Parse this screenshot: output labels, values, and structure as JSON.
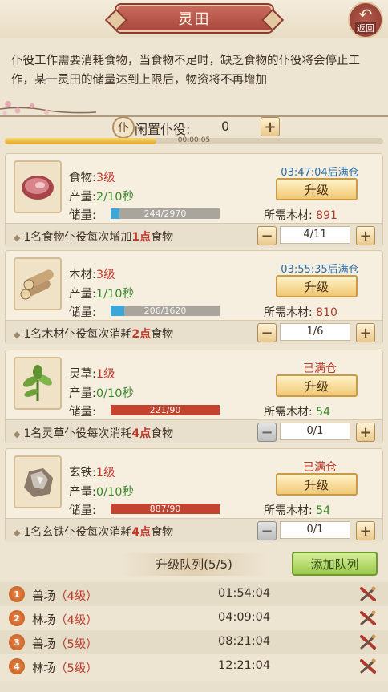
{
  "header": {
    "title": "灵田",
    "back_label": "返回"
  },
  "description": "仆役工作需要消耗食物，当食物不足时，缺乏食物的仆役将会停止工作，某一灵田的储量达到上限后，物资将不再增加",
  "idle": {
    "label": "闲置仆役:",
    "value": "0",
    "timer": "00:00:05",
    "timer_progress": 0.4
  },
  "labels": {
    "output": "产量:",
    "storage": "储量:",
    "wood_needed": "所需木材:",
    "upgrade": "升级"
  },
  "resources": [
    {
      "name": "食物:",
      "level": "3级",
      "rate": "2/10秒",
      "storage_text": "244/2970",
      "fill": 0.082,
      "full": false,
      "status": "03:47:04后满仓",
      "wood": "891",
      "wood_enough": false,
      "note_a": "1名食物仆役每次增加",
      "note_num": "1点",
      "note_b": "食物",
      "count": "4/11",
      "minus_enabled": true,
      "icon": "meat-icon"
    },
    {
      "name": "木材:",
      "level": "3级",
      "rate": "1/10秒",
      "storage_text": "206/1620",
      "fill": 0.127,
      "full": false,
      "status": "03:55:35后满仓",
      "wood": "810",
      "wood_enough": false,
      "note_a": "1名木材仆役每次消耗",
      "note_num": "2点",
      "note_b": "食物",
      "count": "1/6",
      "minus_enabled": true,
      "icon": "log-icon"
    },
    {
      "name": "灵草:",
      "level": "1级",
      "rate": "0/10秒",
      "storage_text": "221/90",
      "fill": 1,
      "full": true,
      "status": "已满仓",
      "wood": "54",
      "wood_enough": true,
      "note_a": "1名灵草仆役每次消耗",
      "note_num": "4点",
      "note_b": "食物",
      "count": "0/1",
      "minus_enabled": false,
      "icon": "herb-icon"
    },
    {
      "name": "玄铁:",
      "level": "1级",
      "rate": "0/10秒",
      "storage_text": "887/90",
      "fill": 1,
      "full": true,
      "status": "已满仓",
      "wood": "54",
      "wood_enough": true,
      "note_a": "1名玄铁仆役每次消耗",
      "note_num": "4点",
      "note_b": "食物",
      "count": "0/1",
      "minus_enabled": false,
      "icon": "iron-ore-icon"
    }
  ],
  "queue": {
    "title": "升级队列(5/5)",
    "add_label": "添加队列",
    "items": [
      {
        "num": "1",
        "name": "兽场",
        "level": "（4级）",
        "time": "01:54:04"
      },
      {
        "num": "2",
        "name": "林场",
        "level": "（4级）",
        "time": "04:09:04"
      },
      {
        "num": "3",
        "name": "兽场",
        "level": "（5级）",
        "time": "08:21:04"
      },
      {
        "num": "4",
        "name": "林场",
        "level": "（5级）",
        "time": "12:21:04"
      }
    ]
  },
  "colors": {
    "accent_red": "#c0392b",
    "bar_blue": "#3ca6d6",
    "bar_red": "#c4432e",
    "status_blue": "#2e6ea6",
    "green": "#3a8a2a"
  }
}
